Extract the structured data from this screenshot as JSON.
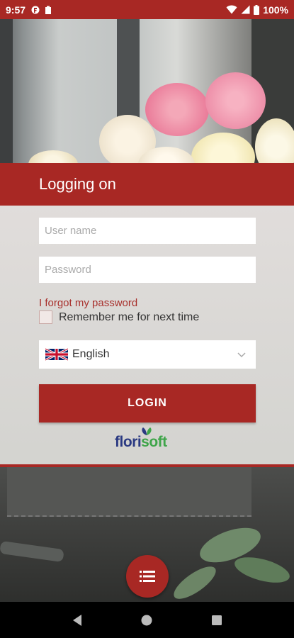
{
  "status_bar": {
    "time": "9:57",
    "battery": "100%",
    "icons": [
      "florisoft-app-icon",
      "clipboard-icon",
      "wifi-icon",
      "signal-icon",
      "battery-icon"
    ]
  },
  "header": {
    "title": "Logging on"
  },
  "form": {
    "username_placeholder": "User name",
    "username_value": "",
    "password_placeholder": "Password",
    "password_value": "",
    "forgot_link": "I forgot my password",
    "remember_label": "Remember me for next time",
    "remember_checked": false,
    "language_selected": "English",
    "language_flag": "uk-flag-icon",
    "login_button": "LOGIN"
  },
  "logo": {
    "part1": "flori",
    "part2": "soft"
  },
  "fab": {
    "icon": "list-menu-icon"
  },
  "nav_bar": {
    "icons": [
      "back-icon",
      "home-icon",
      "recents-icon"
    ]
  },
  "colors": {
    "brand_red": "#a82824",
    "logo_blue": "#2b3a82",
    "logo_green": "#3fa54a",
    "link_red": "#a8302c"
  }
}
